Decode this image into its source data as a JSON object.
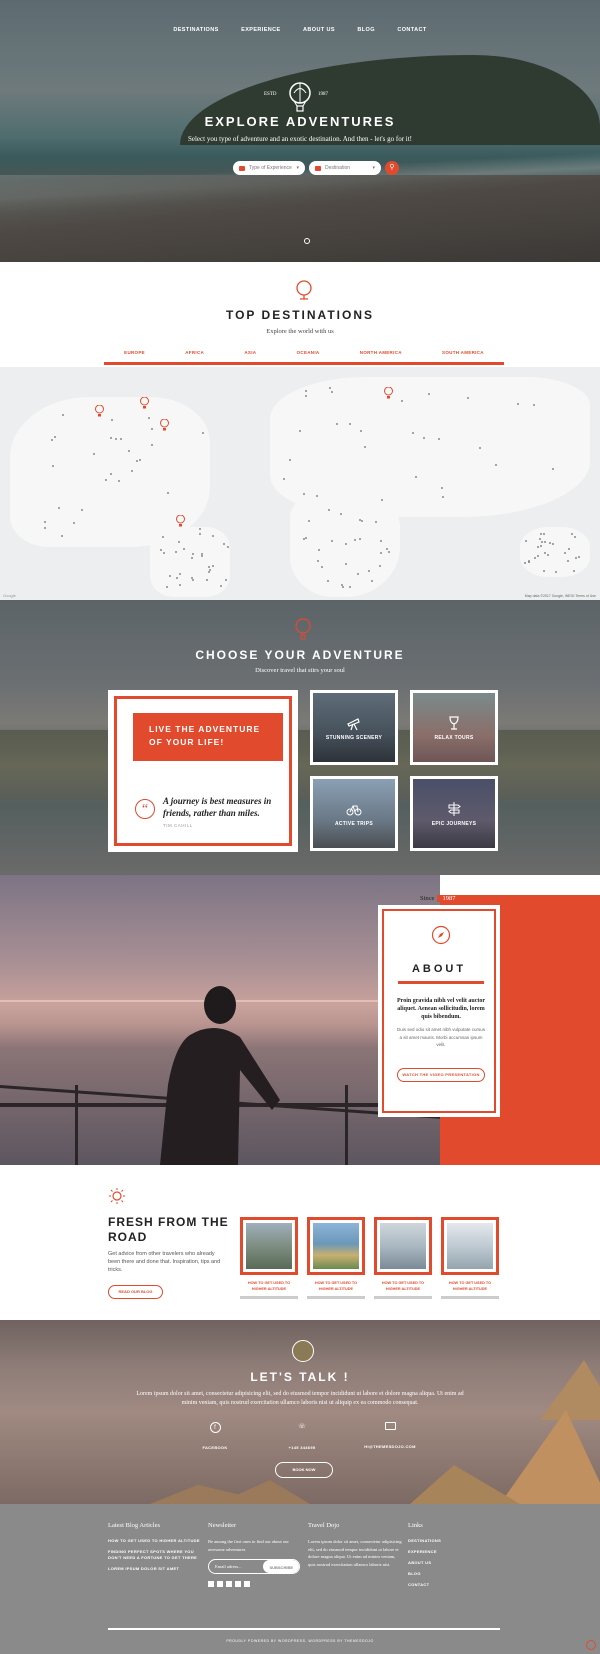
{
  "nav": {
    "items": [
      "DESTINATIONS",
      "EXPERIENCE",
      "ABOUT US",
      "BLOG",
      "CONTACT"
    ]
  },
  "hero": {
    "estd": "ESTD",
    "year": "1987",
    "title": "EXPLORE ADVENTURES",
    "subtitle": "Select you type of adventure and an exotic destination. And then - let's go for it!",
    "experience_placeholder": "Type of Experience",
    "destination_placeholder": "Destination"
  },
  "destinations": {
    "title": "TOP DESTINATIONS",
    "subtitle": "Explore the world with us",
    "tabs": [
      "EUROPE",
      "AFRICA",
      "ASIA",
      "OCEANIA",
      "NORTH AMERICA",
      "SOUTH AMERICA"
    ]
  },
  "map": {
    "attribution": "Map data ©2017 Google, INEGI  Terms of Use",
    "google": "Google"
  },
  "adventure": {
    "title": "CHOOSE YOUR ADVENTURE",
    "subtitle": "Discover travel that stirs your soul",
    "card_heading": "LIVE THE ADVENTURE OF YOUR LIFE!",
    "quote": "A journey is best measures in friends, rather than miles.",
    "author": "TIM CAHILL",
    "tiles": [
      "STUNNING SCENERY",
      "RELAX TOURS",
      "ACTIVE TRIPS",
      "EPIC JOURNEYS"
    ]
  },
  "about": {
    "since_label": "Since",
    "since_year": "1987",
    "title": "ABOUT",
    "lead": "Proin gravida nibh vel velit auctor aliquet. Aenean sollicitudin, lorem quis bibendum.",
    "text": "Duis sed odio sit amet nibh vulputate cursus a sit amet mauris. Morbi accumsan ipsum velit.",
    "button": "WATCH THE VIDEO PRESENTATION"
  },
  "fresh": {
    "title": "FRESH FROM THE ROAD",
    "text": "Get advice from other travelers who already been there and done that. Inspiration, tips and tricks.",
    "button": "READ OUR BLOG",
    "posts": [
      "HOW TO GET USED TO HIGHER ALTITUDE",
      "HOW TO GET USED TO HIGHER ALTITUDE",
      "HOW TO GET USED TO HIGHER ALTITUDE",
      "HOW TO GET USED TO HIGHER ALTITUDE"
    ]
  },
  "talk": {
    "title": "LET'S TALK !",
    "text": "Lorem ipsum dolor sit amet, consectetur adipisicing elit, sed do eiusmod tempor incididunt ut labore et dolore magna aliqua. Ut enim ad minim veniam, quis nostrud exercitation ullamco laboris nisi ut aliquip ex ea commodo consequat.",
    "facebook": "FACEBOOK",
    "phone": "+145 344695",
    "email": "HI@THEMESDOJO.COM",
    "button": "BOOK NOW"
  },
  "footer": {
    "col1_title": "Latest Blog Articles",
    "articles": [
      "HOW TO GET USED TO HIGHER ALTITUDE",
      "FINDING PERFECT SPOTS WHERE YOU DON'T NEED A FORTUNE TO GET THERE",
      "LOREM IPSUM DOLOR SIT AMET"
    ],
    "col2_title": "Newsletter",
    "newsletter_text": "Be among the first ones to find out about our awesome adventures",
    "email_placeholder": "Email adress...",
    "subscribe": "SUBSCRIBE",
    "col3_title": "Travel Dojo",
    "dojo_text": "Lorem ipsum dolor sit amet, consectetur adipisicing elit, sed do eiusmod tempor incididunt ut labore et dolore magna aliqua. Ut enim ad minim veniam, quis nostrud exercitation ullamco laboris nisi.",
    "col4_title": "Links",
    "links": [
      "DESTINATIONS",
      "EXPERIENCE",
      "ABOUT US",
      "BLOG",
      "CONTACT"
    ],
    "copyright": "PROUDLY POWERED BY WORDPRESS. WORDPRESS BY THEMESDOJO"
  },
  "colors": {
    "accent": "#e24a2e",
    "footer": "#8a8a8a"
  }
}
